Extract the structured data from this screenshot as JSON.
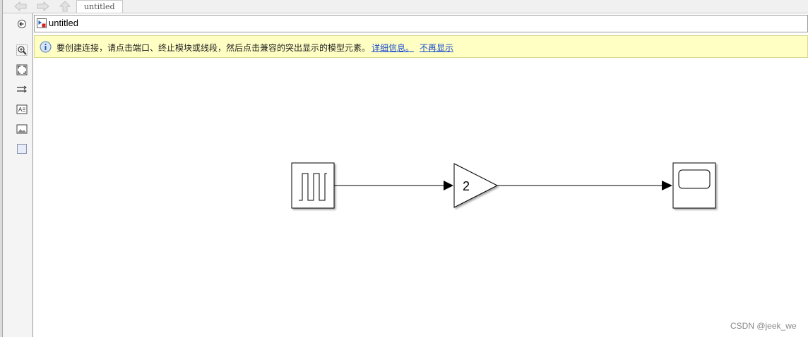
{
  "tab": {
    "title": "untitled"
  },
  "breadcrumb": {
    "label": "untitled"
  },
  "notice": {
    "message": "要创建连接，请点击端口、终止模块或线段，然后点击兼容的突出显示的模型元素。",
    "link_details": "详细信息。",
    "link_dismiss": "不再显示"
  },
  "diagram": {
    "gain_value": "2"
  },
  "watermark": "CSDN @jeek_we",
  "icons": {
    "back": "arrow-left-icon",
    "forward": "arrow-right-icon",
    "up": "arrow-up-icon",
    "info": "info-icon"
  }
}
